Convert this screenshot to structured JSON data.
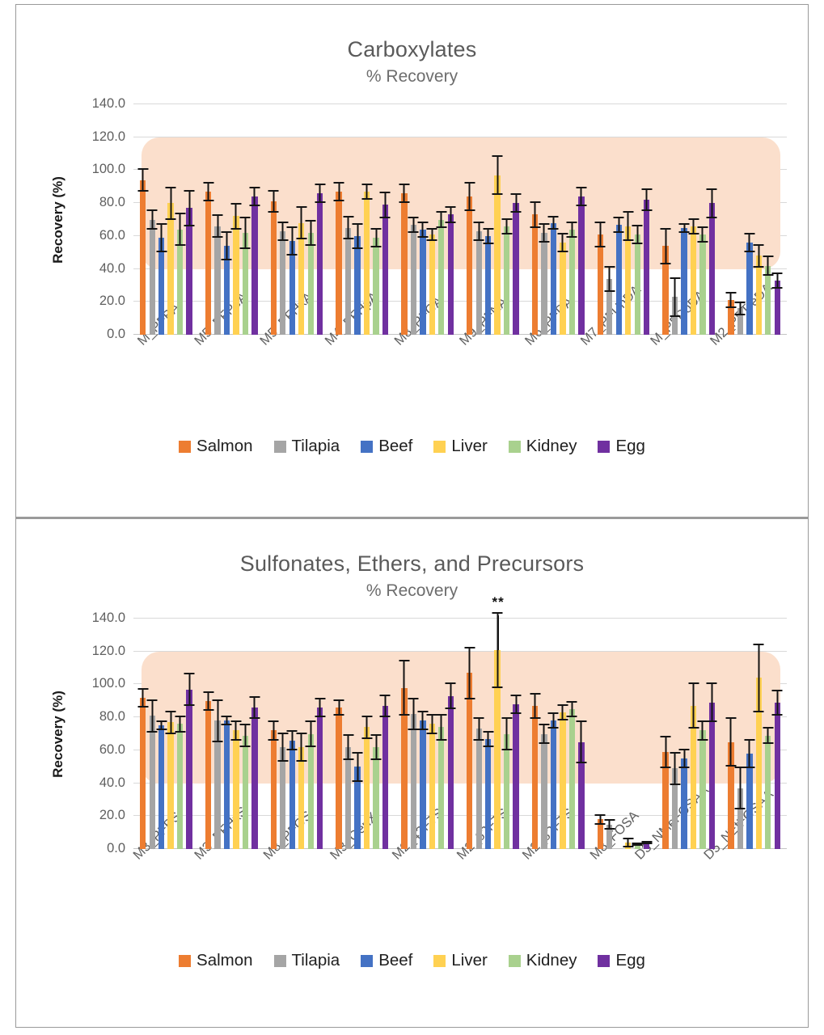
{
  "figure": {
    "series_colors": {
      "Salmon": "#ED7D31",
      "Tilapia": "#A5A5A5",
      "Beef": "#4472C4",
      "Liver": "#FFD152",
      "Kidney": "#A9D18E",
      "Egg": "#7030A0"
    },
    "acceptance_band_color": "#fbdfcc",
    "acceptance_band_range": [
      40,
      120
    ],
    "gridline_color": "#d9d9d9"
  },
  "charts": [
    {
      "panel_name": "carboxylates",
      "chart_data": {
        "type": "bar",
        "title": "Carboxylates",
        "subtitle": "% Recovery",
        "xlabel": "",
        "ylabel": "Recovery (%)",
        "ylim": [
          0,
          140
        ],
        "yticks": [
          "0.0",
          "20.0",
          "40.0",
          "60.0",
          "80.0",
          "100.0",
          "120.0",
          "140.0"
        ],
        "grid": true,
        "legend_position": "bottom",
        "legend": [
          "Salmon",
          "Tilapia",
          "Beef",
          "Liver",
          "Kidney",
          "Egg"
        ],
        "categories": [
          "M_PFBA",
          "M5_PFPeA",
          "M5_PFHxA",
          "M4_PFHpA",
          "M8_PFOA",
          "M9_PFNA",
          "M6_PFDA",
          "M7_PFUnDA",
          "M_PFDoDA",
          "M2_PFTreDA"
        ],
        "series": [
          {
            "name": "Salmon",
            "values": [
              94,
              87,
              81,
              87,
              86,
              84,
              73,
              61,
              54,
              21
            ],
            "errors": [
              7,
              6,
              7,
              6,
              6,
              9,
              8,
              8,
              11,
              5
            ]
          },
          {
            "name": "Tilapia",
            "values": [
              70,
              66,
              63,
              65,
              67,
              63,
              62,
              34,
              23,
              16
            ],
            "errors": [
              6,
              7,
              6,
              7,
              5,
              6,
              6,
              8,
              12,
              4
            ]
          },
          {
            "name": "Beef",
            "values": [
              59,
              54,
              57,
              60,
              64,
              60,
              68,
              67,
              65,
              56
            ],
            "errors": [
              9,
              9,
              9,
              8,
              5,
              5,
              4,
              5,
              3,
              6
            ]
          },
          {
            "name": "Liver",
            "values": [
              80,
              72,
              68,
              87,
              61,
              97,
              56,
              66,
              66,
              48
            ],
            "errors": [
              10,
              8,
              10,
              5,
              4,
              12,
              6,
              9,
              5,
              7
            ]
          },
          {
            "name": "Kidney",
            "values": [
              64,
              62,
              62,
              59,
              70,
              66,
              64,
              61,
              61,
              42
            ],
            "errors": [
              10,
              10,
              8,
              6,
              5,
              5,
              5,
              6,
              5,
              6
            ]
          },
          {
            "name": "Egg",
            "values": [
              77,
              84,
              86,
              79,
              73,
              80,
              84,
              82,
              80,
              33
            ],
            "errors": [
              11,
              6,
              6,
              8,
              5,
              6,
              6,
              7,
              9,
              5
            ]
          }
        ],
        "annotations": []
      }
    },
    {
      "panel_name": "sulfonates",
      "chart_data": {
        "type": "bar",
        "title": "Sulfonates, Ethers, and Precursors",
        "subtitle": "% Recovery",
        "xlabel": "",
        "ylabel": "Recovery (%)",
        "ylim": [
          0,
          140
        ],
        "yticks": [
          "0.0",
          "20.0",
          "40.0",
          "60.0",
          "80.0",
          "100.0",
          "120.0",
          "140.0"
        ],
        "grid": true,
        "legend_position": "bottom",
        "legend": [
          "Salmon",
          "Tilapia",
          "Beef",
          "Liver",
          "Kidney",
          "Egg"
        ],
        "categories": [
          "M3_PFBS",
          "M3_PFHxS",
          "M8_PFOS",
          "M3_GenX",
          "M2_42FTS",
          "M2_62FTS",
          "M2_82FTS",
          "M8_FOSA",
          "D3_NMeFOSAA",
          "D5_NEtFOSAA"
        ],
        "series": [
          {
            "name": "Salmon",
            "values": [
              92,
              90,
              72,
              86,
              98,
              107,
              87,
              18,
              59,
              65
            ],
            "errors": [
              6,
              6,
              6,
              5,
              17,
              16,
              8,
              3,
              10,
              15
            ]
          },
          {
            "name": "Tilapia",
            "values": [
              81,
              78,
              62,
              62,
              82,
              73,
              70,
              15,
              49,
              37
            ],
            "errors": [
              10,
              13,
              9,
              8,
              10,
              7,
              6,
              3,
              10,
              13
            ]
          },
          {
            "name": "Beef",
            "values": [
              75,
              78,
              66,
              50,
              78,
              67,
              78,
              0,
              55,
              58
            ],
            "errors": [
              3,
              3,
              6,
              9,
              6,
              5,
              5,
              0,
              6,
              9
            ]
          },
          {
            "name": "Liver",
            "values": [
              77,
              72,
              62,
              74,
              76,
              121,
              83,
              4,
              87,
              104
            ],
            "errors": [
              7,
              6,
              9,
              7,
              6,
              23,
              5,
              3,
              14,
              21
            ]
          },
          {
            "name": "Kidney",
            "values": [
              76,
              69,
              70,
              62,
              74,
              70,
              85,
              3,
              72,
              69
            ],
            "errors": [
              5,
              7,
              8,
              8,
              8,
              10,
              5,
              1,
              6,
              5
            ]
          },
          {
            "name": "Egg",
            "values": [
              97,
              86,
              86,
              87,
              93,
              88,
              65,
              4,
              89,
              89
            ],
            "errors": [
              10,
              7,
              6,
              7,
              8,
              6,
              13,
              1,
              12,
              8
            ]
          }
        ],
        "annotations": [
          {
            "text": "**",
            "category": "M2_62FTS",
            "series": "Liver",
            "value": 145
          }
        ]
      }
    }
  ]
}
